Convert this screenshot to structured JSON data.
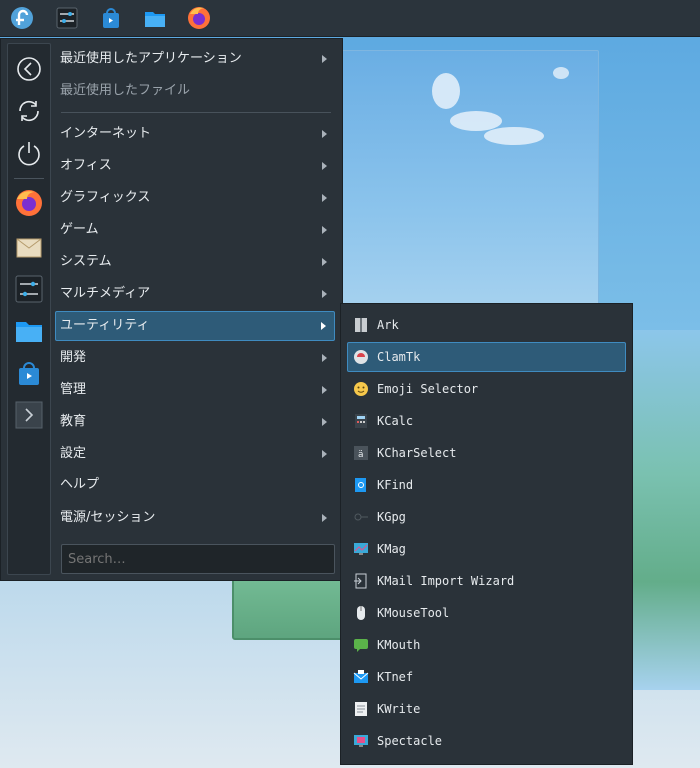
{
  "taskbar": {
    "items": [
      {
        "name": "application-launcher-icon"
      },
      {
        "name": "system-settings-icon"
      },
      {
        "name": "discover-store-icon"
      },
      {
        "name": "file-manager-icon"
      },
      {
        "name": "firefox-icon"
      }
    ]
  },
  "favorites": [
    "back-icon",
    "refresh-icon",
    "power-icon",
    "firefox-icon",
    "mail-icon",
    "settings-icon",
    "folder-icon",
    "store-icon",
    "terminal-icon"
  ],
  "menu": {
    "recent_apps": "最近使用したアプリケーション",
    "recent_files": "最近使用したファイル",
    "categories": [
      {
        "label": "インターネット",
        "submenu": true
      },
      {
        "label": "オフィス",
        "submenu": true
      },
      {
        "label": "グラフィックス",
        "submenu": true
      },
      {
        "label": "ゲーム",
        "submenu": true
      },
      {
        "label": "システム",
        "submenu": true
      },
      {
        "label": "マルチメディア",
        "submenu": true
      },
      {
        "label": "ユーティリティ",
        "submenu": true,
        "selected": true
      },
      {
        "label": "開発",
        "submenu": true
      },
      {
        "label": "管理",
        "submenu": true
      },
      {
        "label": "教育",
        "submenu": true
      },
      {
        "label": "設定",
        "submenu": true
      },
      {
        "label": "ヘルプ",
        "submenu": false
      },
      {
        "label": "電源/セッション",
        "submenu": true
      }
    ],
    "search_placeholder": "Search…"
  },
  "submenu": {
    "items": [
      {
        "label": "Ark",
        "icon": "archive-icon"
      },
      {
        "label": "ClamTk",
        "icon": "antivirus-icon",
        "selected": true
      },
      {
        "label": "Emoji Selector",
        "icon": "emoji-icon"
      },
      {
        "label": "KCalc",
        "icon": "calculator-icon"
      },
      {
        "label": "KCharSelect",
        "icon": "character-icon"
      },
      {
        "label": "KFind",
        "icon": "find-icon"
      },
      {
        "label": "KGpg",
        "icon": "key-icon"
      },
      {
        "label": "KMag",
        "icon": "magnifier-icon"
      },
      {
        "label": "KMail Import Wizard",
        "icon": "import-icon"
      },
      {
        "label": "KMouseTool",
        "icon": "mouse-icon"
      },
      {
        "label": "KMouth",
        "icon": "speech-icon"
      },
      {
        "label": "KTnef",
        "icon": "envelope-icon"
      },
      {
        "label": "KWrite",
        "icon": "text-editor-icon"
      },
      {
        "label": "Spectacle",
        "icon": "screenshot-icon"
      }
    ]
  },
  "colors": {
    "accent": "#3f8bc0",
    "selection_bg": "#2e5b78",
    "panel_bg": "#2a3239",
    "text": "#e8ecef"
  }
}
